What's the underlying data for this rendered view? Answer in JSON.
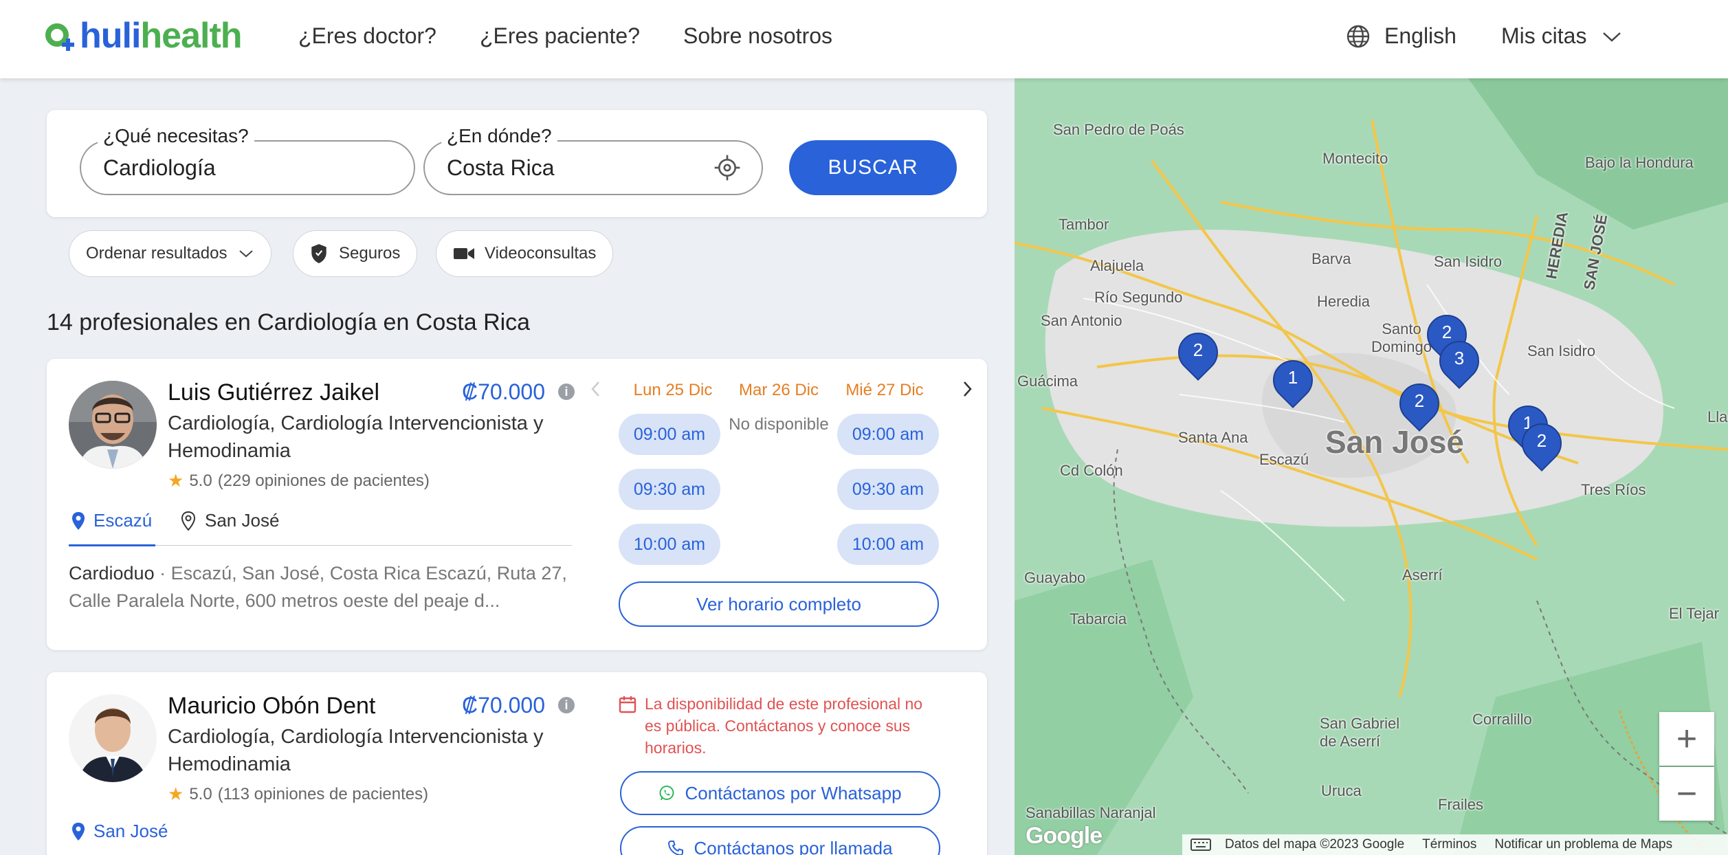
{
  "header": {
    "logo_hulu": "huli",
    "logo_health": "health",
    "nav": [
      "¿Eres doctor?",
      "¿Eres paciente?",
      "Sobre nosotros"
    ],
    "language": "English",
    "appointments": "Mis citas"
  },
  "search": {
    "what_label": "¿Qué necesitas?",
    "what_value": "Cardiología",
    "where_label": "¿En dónde?",
    "where_value": "Costa Rica",
    "button": "BUSCAR"
  },
  "filters": {
    "sort": "Ordenar resultados",
    "insurance": "Seguros",
    "video": "Videoconsultas"
  },
  "results_title": "14 profesionales en Cardiología en Costa Rica",
  "doctors": [
    {
      "name": "Luis Gutiérrez Jaikel",
      "price": "₡70.000",
      "specialty": "Cardiología, Cardiología Intervencionista y Hemodinamia",
      "rating_value": "5.0",
      "rating_text": "(229 opiniones de pacientes)",
      "location_tabs": [
        "Escazú",
        "San José"
      ],
      "clinic": "Cardioduo",
      "address": " · Escazú, San José, Costa Rica Escazú, Ruta 27, Calle Paralela Norte, 600 metros oeste del peaje d...",
      "days": [
        "Lun 25 Dic",
        "Mar 26 Dic",
        "Mié 27 Dic"
      ],
      "day1_slots": [
        "09:00 am",
        "09:30 am",
        "10:00 am"
      ],
      "day2_unavailable": "No disponible",
      "day3_slots": [
        "09:00 am",
        "09:30 am",
        "10:00 am"
      ],
      "full_schedule": "Ver horario completo"
    },
    {
      "name": "Mauricio Obón Dent",
      "price": "₡70.000",
      "specialty": "Cardiología, Cardiología Intervencionista y Hemodinamia",
      "rating_value": "5.0",
      "rating_text": "(113 opiniones de pacientes)",
      "location_tabs": [
        "San José"
      ],
      "availability_notice": "La disponibilidad de este profesional no es pública. Contáctanos y conoce sus horarios.",
      "whatsapp": "Contáctanos por Whatsapp",
      "call": "Contáctanos por llamada"
    }
  ],
  "map": {
    "places": [
      {
        "name": "San Pedro de Poás"
      },
      {
        "name": "Montecito"
      },
      {
        "name": "Bajo la Hondura"
      },
      {
        "name": "Tambor"
      },
      {
        "name": "Barva"
      },
      {
        "name": "San Isidro"
      },
      {
        "name": "HEREDIA"
      },
      {
        "name": "SAN JOSÉ"
      },
      {
        "name": "Alajuela"
      },
      {
        "name": "Heredia"
      },
      {
        "name": "Río Segundo"
      },
      {
        "name": "San Antonio"
      },
      {
        "name": "Santo Domingo"
      },
      {
        "name": "Guácima"
      },
      {
        "name": "San Isidro"
      },
      {
        "name": "Santa Ana"
      },
      {
        "name": "Escazú"
      },
      {
        "name": "San José"
      },
      {
        "name": "Cd Colón"
      },
      {
        "name": "Tres Ríos"
      },
      {
        "name": "Guayabo"
      },
      {
        "name": "Aserrí"
      },
      {
        "name": "El Tejar"
      },
      {
        "name": "Tabarcia"
      },
      {
        "name": "Corralillo"
      },
      {
        "name": "San Gabriel de Aserrí"
      },
      {
        "name": "Uruca"
      },
      {
        "name": "Frailes"
      },
      {
        "name": "Sanabillas Naranjal"
      },
      {
        "name": "Lla"
      }
    ],
    "pins": [
      "2",
      "1",
      "2",
      "3",
      "2",
      "1",
      "2"
    ],
    "zoom_in": "+",
    "zoom_out": "−",
    "google": "Google",
    "footer": {
      "data": "Datos del mapa ©2023 Google",
      "terms": "Términos",
      "report": "Notificar un problema de Maps"
    }
  }
}
